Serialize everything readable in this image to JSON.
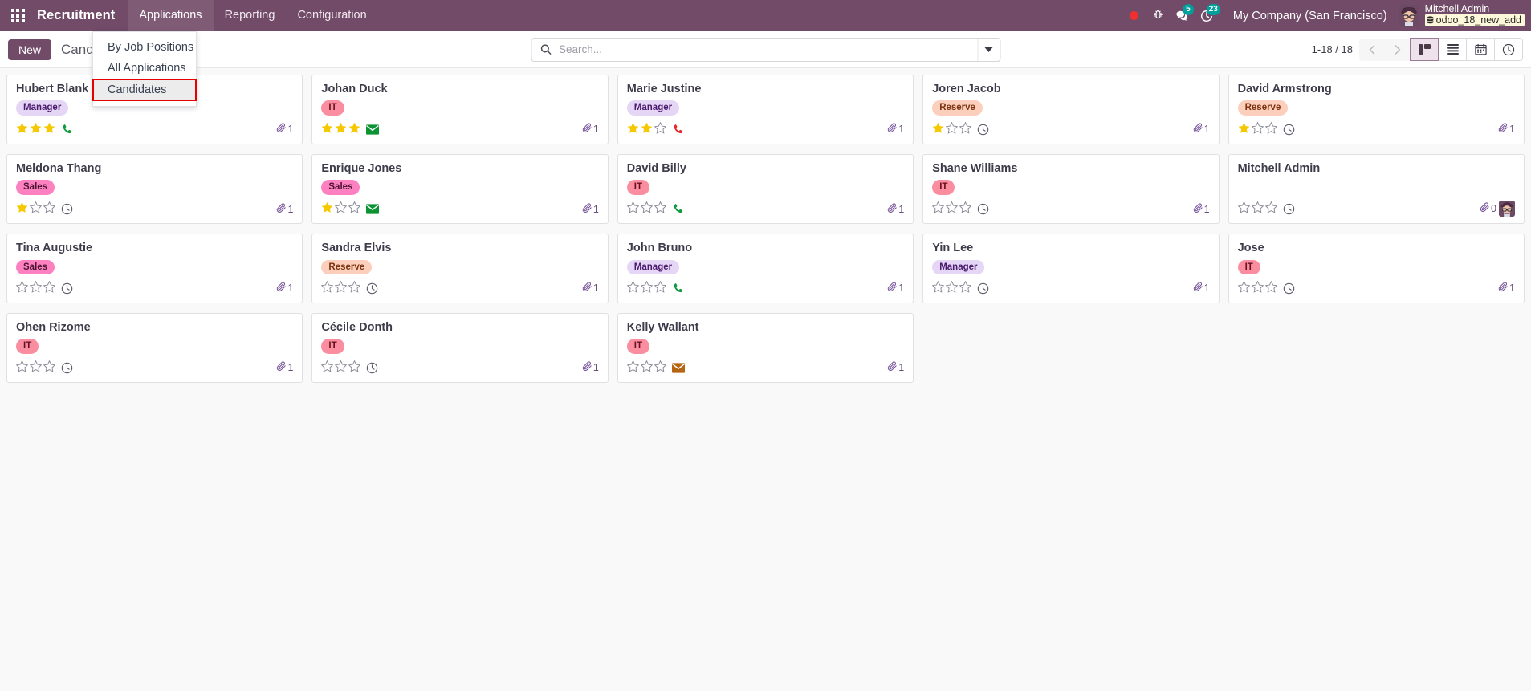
{
  "navbar": {
    "apps_icon": "apps-grid-icon",
    "brand": "Recruitment",
    "menus": [
      {
        "label": "Applications",
        "active": true
      },
      {
        "label": "Reporting",
        "active": false
      },
      {
        "label": "Configuration",
        "active": false
      }
    ],
    "recording_icon": "record-dot-icon",
    "debug_icon": "bug-icon",
    "messages_icon": "messages-icon",
    "messages_count": "5",
    "activities_icon": "activity-clock-icon",
    "activities_count": "23",
    "company": "My Company (San Francisco)",
    "avatar_icon": "user-avatar",
    "user_name": "Mitchell Admin",
    "database_icon": "database-icon",
    "database": "odoo_18_new_add",
    "brand_color": "#714B67",
    "badge_color": "#00a09d"
  },
  "dropdown": {
    "items": [
      {
        "label": "By Job Positions",
        "highlighted": false
      },
      {
        "label": "All Applications",
        "highlighted": false
      },
      {
        "label": "Candidates",
        "highlighted": true
      }
    ],
    "highlight_border_color": "#e80000"
  },
  "control_panel": {
    "new_label": "New",
    "breadcrumb": "Candidates",
    "search_icon": "search-icon",
    "search_value": "",
    "search_placeholder": "Search...",
    "search_caret_icon": "chevron-down-icon",
    "pager": "1-18 / 18",
    "prev_icon": "chevron-left-icon",
    "next_icon": "chevron-right-icon",
    "views": [
      {
        "name": "kanban",
        "icon": "kanban-view-icon",
        "active": true
      },
      {
        "name": "list",
        "icon": "list-view-icon",
        "active": false
      },
      {
        "name": "calendar",
        "icon": "calendar-view-icon",
        "active": false
      },
      {
        "name": "activity",
        "icon": "activity-view-icon",
        "active": false
      }
    ]
  },
  "kanban": {
    "cards": [
      {
        "name": "Hubert Blank",
        "tag": "Manager",
        "tag_class": "tag-manager",
        "stars": 3,
        "activity": "phone",
        "activity_color": "#0f9b3e",
        "attachments": "1",
        "avatar": false
      },
      {
        "name": "Johan Duck",
        "tag": "IT",
        "tag_class": "tag-it",
        "stars": 3,
        "activity": "mail",
        "activity_color": "#0c9434",
        "attachments": "1",
        "avatar": false
      },
      {
        "name": "Marie Justine",
        "tag": "Manager",
        "tag_class": "tag-manager",
        "stars": 2,
        "activity": "phone",
        "activity_color": "#e8262d",
        "attachments": "1",
        "avatar": false
      },
      {
        "name": "Joren Jacob",
        "tag": "Reserve",
        "tag_class": "tag-reserve",
        "stars": 1,
        "activity": "clock",
        "activity_color": "#5c5c6b",
        "attachments": "1",
        "avatar": false
      },
      {
        "name": "David Armstrong",
        "tag": "Reserve",
        "tag_class": "tag-reserve",
        "stars": 1,
        "activity": "clock",
        "activity_color": "#5c5c6b",
        "attachments": "1",
        "avatar": false
      },
      {
        "name": "Meldona Thang",
        "tag": "Sales",
        "tag_class": "tag-sales",
        "stars": 1,
        "activity": "clock",
        "activity_color": "#5c5c6b",
        "attachments": "1",
        "avatar": false
      },
      {
        "name": "Enrique Jones",
        "tag": "Sales",
        "tag_class": "tag-sales",
        "stars": 1,
        "activity": "mail",
        "activity_color": "#0c9434",
        "attachments": "1",
        "avatar": false
      },
      {
        "name": "David Billy",
        "tag": "IT",
        "tag_class": "tag-it",
        "stars": 0,
        "activity": "phone",
        "activity_color": "#0f9b3e",
        "attachments": "1",
        "avatar": false
      },
      {
        "name": "Shane Williams",
        "tag": "IT",
        "tag_class": "tag-it",
        "stars": 0,
        "activity": "clock",
        "activity_color": "#5c5c6b",
        "attachments": "1",
        "avatar": false
      },
      {
        "name": "Mitchell Admin",
        "tag": "",
        "tag_class": "",
        "stars": 0,
        "activity": "clock",
        "activity_color": "#5c5c6b",
        "attachments": "0",
        "avatar": true
      },
      {
        "name": "Tina Augustie",
        "tag": "Sales",
        "tag_class": "tag-sales",
        "stars": 0,
        "activity": "clock",
        "activity_color": "#5c5c6b",
        "attachments": "1",
        "avatar": false
      },
      {
        "name": "Sandra Elvis",
        "tag": "Reserve",
        "tag_class": "tag-reserve",
        "stars": 0,
        "activity": "clock",
        "activity_color": "#5c5c6b",
        "attachments": "1",
        "avatar": false
      },
      {
        "name": "John Bruno",
        "tag": "Manager",
        "tag_class": "tag-manager",
        "stars": 0,
        "activity": "phone",
        "activity_color": "#0f9b3e",
        "attachments": "1",
        "avatar": false
      },
      {
        "name": "Yin Lee",
        "tag": "Manager",
        "tag_class": "tag-manager",
        "stars": 0,
        "activity": "clock",
        "activity_color": "#5c5c6b",
        "attachments": "1",
        "avatar": false
      },
      {
        "name": "Jose",
        "tag": "IT",
        "tag_class": "tag-it",
        "stars": 0,
        "activity": "clock",
        "activity_color": "#5c5c6b",
        "attachments": "1",
        "avatar": false
      },
      {
        "name": "Ohen Rizome",
        "tag": "IT",
        "tag_class": "tag-it",
        "stars": 0,
        "activity": "clock",
        "activity_color": "#5c5c6b",
        "attachments": "1",
        "avatar": false
      },
      {
        "name": "Cécile Donth",
        "tag": "IT",
        "tag_class": "tag-it",
        "stars": 0,
        "activity": "clock",
        "activity_color": "#5c5c6b",
        "attachments": "1",
        "avatar": false
      },
      {
        "name": "Kelly Wallant",
        "tag": "IT",
        "tag_class": "tag-it",
        "stars": 0,
        "activity": "mail",
        "activity_color": "#b5640f",
        "attachments": "1",
        "avatar": false
      }
    ],
    "star_max": 3,
    "star_on_color": "#f6c800",
    "star_off_color": "#8d8d9b",
    "attachment_icon": "paperclip-icon"
  }
}
